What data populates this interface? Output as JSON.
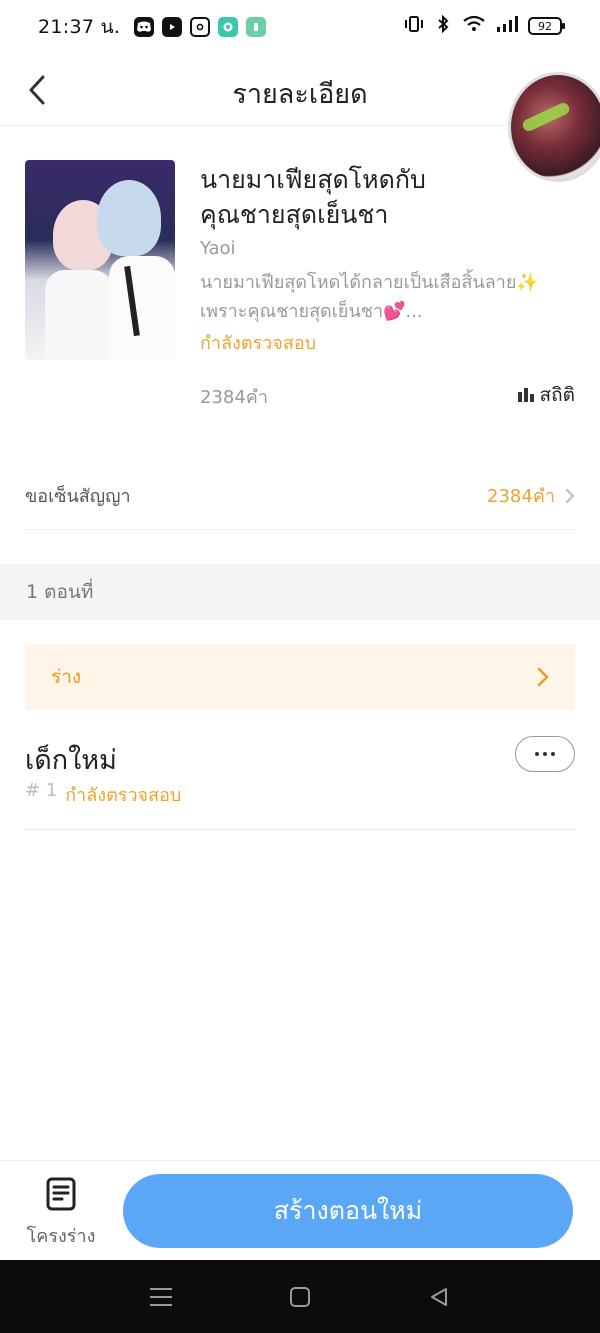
{
  "status_bar": {
    "time": "21:37 น.",
    "battery": "92",
    "apps": [
      "discord-icon",
      "youtube-icon",
      "instagram-icon",
      "chat-app-icon",
      "tiktok-icon"
    ],
    "indicators": [
      "vibrate-icon",
      "bluetooth-icon",
      "wifi-icon",
      "signal-icon"
    ]
  },
  "header": {
    "title": "รายละเอียด"
  },
  "book": {
    "title": "นายมาเฟียสุดโหดกับคุณชายสุดเย็นชา",
    "genre": "Yaoi",
    "description": "นายมาเฟียสุดโหดได้กลายเป็นเสือสิ้นลาย✨ เพราะคุณชายสุดเย็นชา💕...",
    "status": "กำลังตรวจสอบ",
    "word_count": "2384คำ",
    "stats_label": "สถิติ"
  },
  "contract": {
    "label": "ขอเซ็นสัญญา",
    "value": "2384คำ"
  },
  "episodes": {
    "count_label": "1 ตอนที่"
  },
  "draft": {
    "label": "ร่าง"
  },
  "chapter": {
    "title": "เด็กใหม่",
    "number": "# 1",
    "status": "กำลังตรวจสอบ"
  },
  "bottom": {
    "outline_label": "โครงร่าง",
    "new_chapter_label": "สร้างตอนใหม่"
  },
  "colors": {
    "accent_orange": "#f0a22e",
    "primary_blue": "#5aa8f5",
    "draft_bg": "#fff4e8"
  }
}
